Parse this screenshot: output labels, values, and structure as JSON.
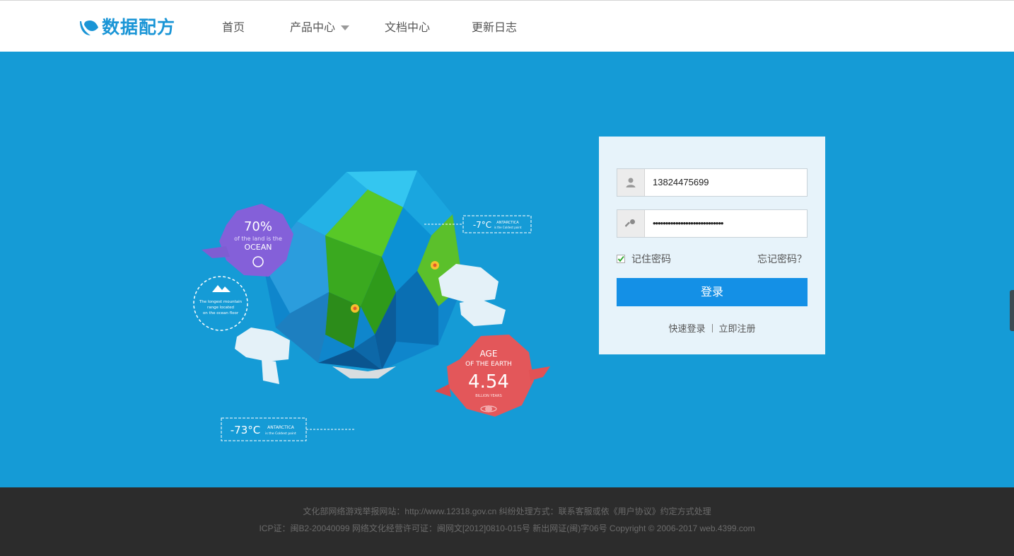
{
  "brand": {
    "name": "数据配方",
    "color": "#1a95d6"
  },
  "nav": {
    "items": [
      {
        "label": "首页"
      },
      {
        "label": "产品中心",
        "has_dropdown": true
      },
      {
        "label": "文档中心"
      },
      {
        "label": "更新日志"
      }
    ]
  },
  "illustration": {
    "land_percent": "70%",
    "land_line1": "of the land is the",
    "land_line2": "OCEAN",
    "mountain_line1": "The longest mountain",
    "mountain_line2": "range located",
    "mountain_line3": "on the ocean floor",
    "temp_top": "-7°C",
    "temp_top_label": "ANTARCTICA",
    "temp_top_sub": "is the Coldest point",
    "temp_bottom": "-73°C",
    "temp_bottom_label": "ANTARCTICA",
    "temp_bottom_sub": "is the Coldest point",
    "age_line1": "AGE",
    "age_line2": "OF THE EARTH",
    "age_value": "4.54",
    "age_unit": "BILLION YEARS"
  },
  "login": {
    "username_value": "13824475699",
    "username_icon": "user-icon",
    "password_value": "••••••••••••••••••••••••••••",
    "password_icon": "key-icon",
    "remember_label": "记住密码",
    "remember_checked": true,
    "forgot_label": "忘记密码？",
    "submit_label": "登录",
    "quick_login_label": "快速登录",
    "register_label": "立即注册"
  },
  "footer": {
    "line1": "文化部网络游戏举报网站：http://www.12318.gov.cn 纠纷处理方式：联系客服或依《用户协议》约定方式处理",
    "line2": "ICP证：闽B2-20040099 网络文化经营许可证：闽网文[2012]0810-015号 新出网证(闽)字06号 Copyright © 2006-2017 web.4399.com"
  },
  "colors": {
    "main_bg": "#159bd6",
    "login_button": "#1490e6",
    "footer_bg": "#2c2c2c"
  }
}
